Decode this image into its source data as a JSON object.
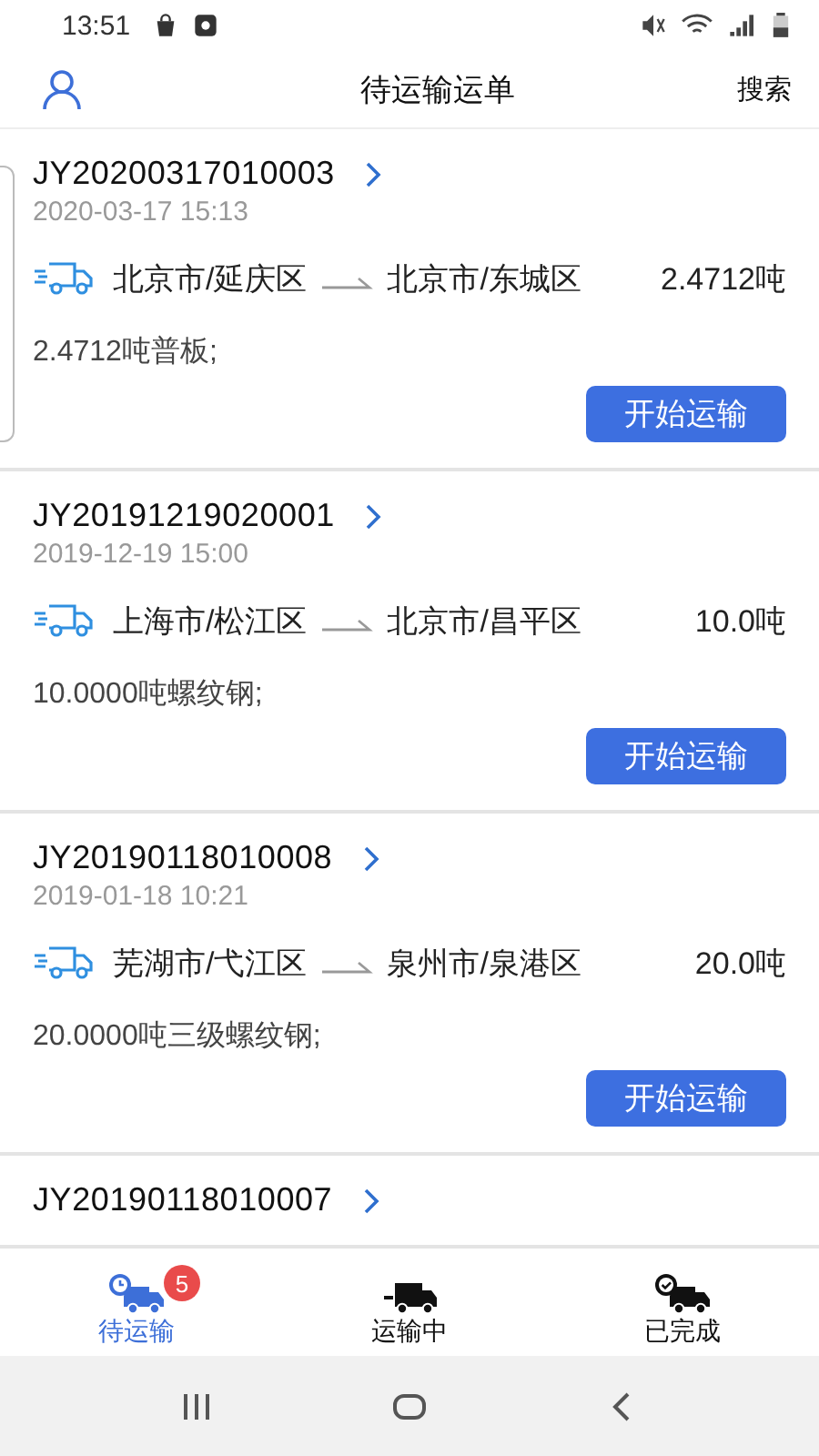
{
  "status_bar": {
    "time": "13:51"
  },
  "header": {
    "title": "待运输运单",
    "action": "搜索"
  },
  "orders": [
    {
      "id": "JY20200317010003",
      "date": "2020-03-17 15:13",
      "from": "北京市/延庆区",
      "to": "北京市/东城区",
      "weight": "2.4712吨",
      "cargo": "2.4712吨普板;",
      "button": "开始运输"
    },
    {
      "id": "JY20191219020001",
      "date": "2019-12-19 15:00",
      "from": "上海市/松江区",
      "to": "北京市/昌平区",
      "weight": "10.0吨",
      "cargo": "10.0000吨螺纹钢;",
      "button": "开始运输"
    },
    {
      "id": "JY20190118010008",
      "date": "2019-01-18 10:21",
      "from": "芜湖市/弋江区",
      "to": "泉州市/泉港区",
      "weight": "20.0吨",
      "cargo": "20.0000吨三级螺纹钢;",
      "button": "开始运输"
    },
    {
      "id": "JY20190118010007"
    }
  ],
  "tabs": [
    {
      "kind": "pending",
      "label": "待运输",
      "selected": true,
      "badge": "5"
    },
    {
      "kind": "moving",
      "label": "运输中",
      "selected": false
    },
    {
      "kind": "done",
      "label": "已完成",
      "selected": false
    }
  ]
}
